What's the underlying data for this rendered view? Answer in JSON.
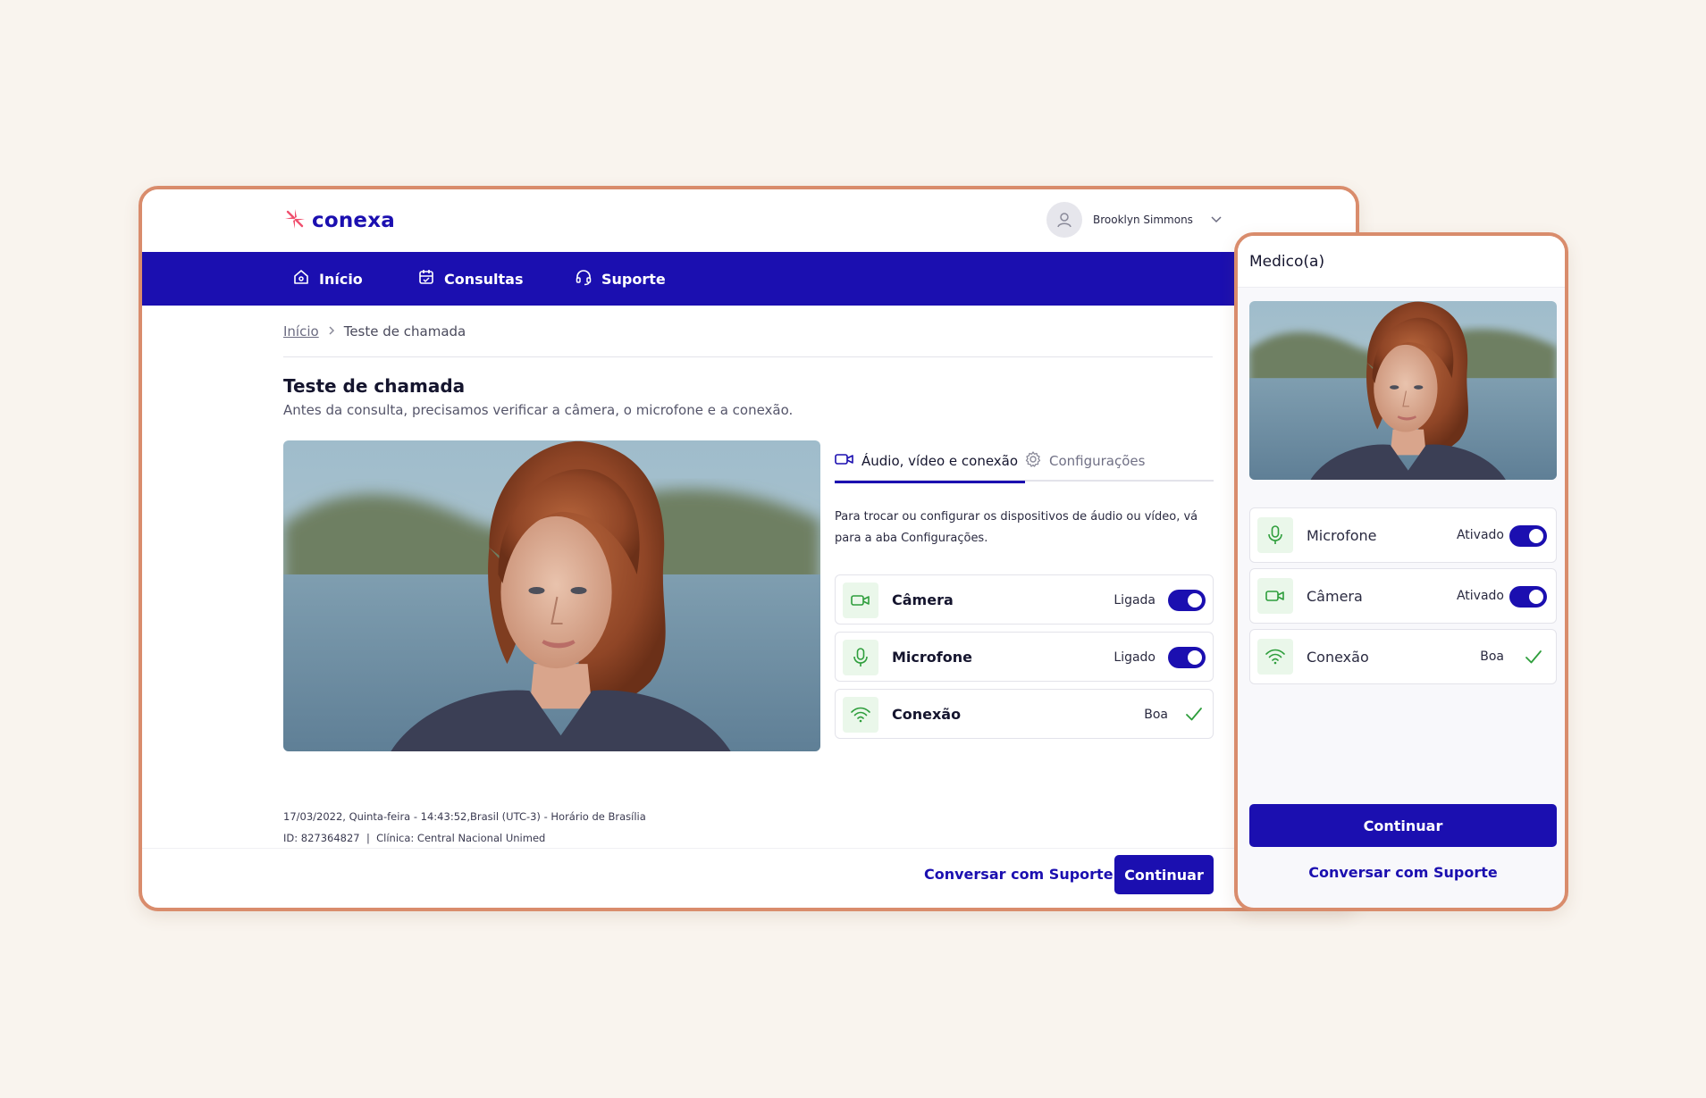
{
  "brand": {
    "name": "conexa"
  },
  "user": {
    "name": "Brooklyn Simmons"
  },
  "nav": [
    {
      "label": "Início",
      "icon": "home-icon"
    },
    {
      "label": "Consultas",
      "icon": "calendar-icon"
    },
    {
      "label": "Suporte",
      "icon": "headset-icon"
    }
  ],
  "breadcrumb": {
    "home": "Início",
    "current": "Teste de chamada"
  },
  "page": {
    "title": "Teste de chamada",
    "subtitle": "Antes da consulta, precisamos verificar a câmera, o microfone e a conexão."
  },
  "tabs": {
    "active": "Áudio, vídeo e conexão",
    "inactive": "Configurações"
  },
  "tab_description": "Para trocar ou configurar os dispositivos de áudio ou vídeo, vá para a aba Configurações.",
  "devices": [
    {
      "label": "Câmera",
      "status": "Ligada",
      "control": "toggle",
      "on": true,
      "icon": "video-camera-icon"
    },
    {
      "label": "Microfone",
      "status": "Ligado",
      "control": "toggle",
      "on": true,
      "icon": "microphone-icon"
    },
    {
      "label": "Conexão",
      "status": "Boa",
      "control": "check",
      "icon": "wifi-icon"
    }
  ],
  "footer": {
    "datetime": "17/03/2022, Quinta-feira - 14:43:52,Brasil (UTC-3) - Horário de Brasília",
    "meta": "ID: 827364827  |  Clínica: Central Nacional Unimed"
  },
  "actions": {
    "support": "Conversar com Suporte",
    "continue": "Continuar"
  },
  "mobile": {
    "title": "Medico(a)",
    "devices": [
      {
        "label": "Microfone",
        "status": "Ativado",
        "control": "toggle",
        "on": true,
        "icon": "microphone-icon"
      },
      {
        "label": "Câmera",
        "status": "Ativado",
        "control": "toggle",
        "on": true,
        "icon": "video-camera-icon"
      },
      {
        "label": "Conexão",
        "status": "Boa",
        "control": "check",
        "icon": "wifi-icon"
      }
    ],
    "continue": "Continuar",
    "support": "Conversar com Suporte"
  },
  "colors": {
    "primary": "#1b0fb0",
    "frame_border": "#d98c6c",
    "background": "#f9f4ee",
    "icon_bg": "#eaf7ea",
    "icon_green": "#2e9e3c",
    "logo_accent": "#f0506e"
  }
}
